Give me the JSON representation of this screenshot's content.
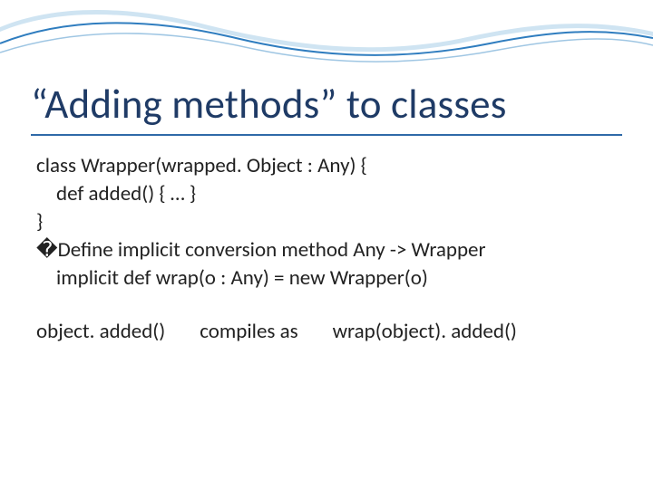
{
  "title": "“Adding methods” to classes",
  "code": {
    "l1": "class Wrapper(wrapped. Object : Any) {",
    "l2": "def added() { … }",
    "l3": "}",
    "l4": "�Define implicit conversion method Any -> Wrapper",
    "l5": "implicit def wrap(o : Any) = new Wrapper(o)"
  },
  "example": {
    "left": "object. added()",
    "mid": "compiles as",
    "right": "wrap(object). added()"
  },
  "colors": {
    "title": "#1f3b66",
    "underline": "#2f6aa8",
    "wave1": "#a9cde8",
    "wave2": "#2f7dbf"
  }
}
